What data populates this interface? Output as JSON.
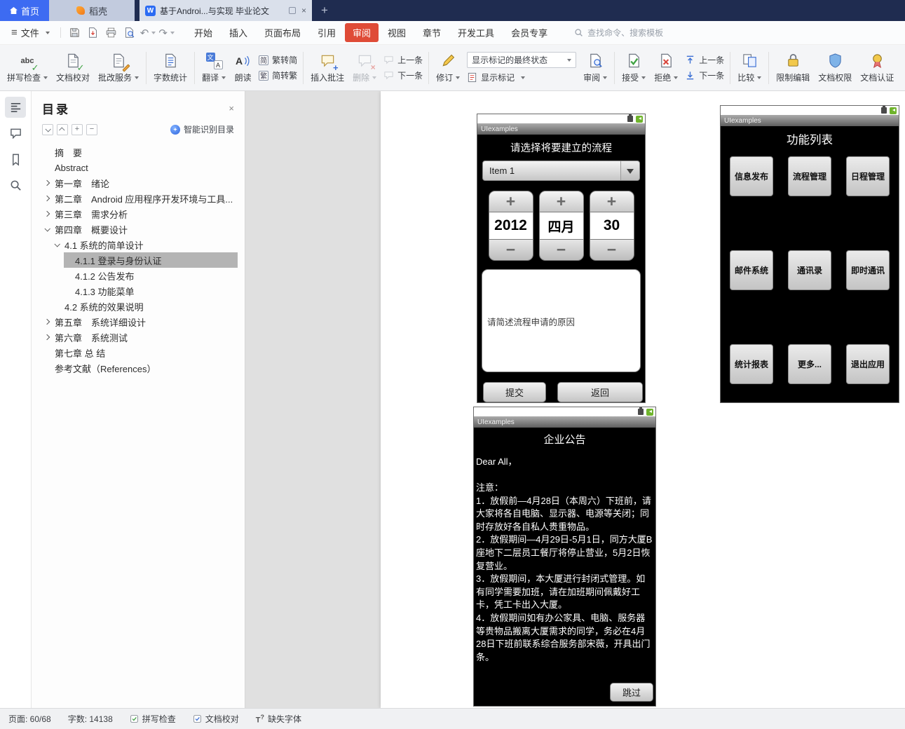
{
  "titlebar": {
    "home_tab": "首页",
    "docer_tab": "稻壳",
    "doc_tab": "基于Androi...与实现 毕业论文"
  },
  "menubar": {
    "file": "文件",
    "tabs": [
      "开始",
      "插入",
      "页面布局",
      "引用",
      "审阅",
      "视图",
      "章节",
      "开发工具",
      "会员专享"
    ],
    "search": "查找命令、搜索模板"
  },
  "ribbon": {
    "spell_check": "拼写检查",
    "doc_proof": "文档校对",
    "correction_service": "批改服务",
    "word_count": "字数统计",
    "translate": "翻译",
    "read_aloud": "朗读",
    "trad_to_simp": "繁转简",
    "simp_to_trad": "简转繁",
    "insert_comment": "插入批注",
    "delete_comment": "删除",
    "prev_comment": "上一条",
    "next_comment": "下一条",
    "track_changes": "修订",
    "markup_state": "显示标记的最终状态",
    "show_markup": "显示标记",
    "review": "审阅",
    "accept": "接受",
    "reject": "拒绝",
    "prev_change": "上一条",
    "next_change": "下一条",
    "compare": "比较",
    "restrict_edit": "限制编辑",
    "doc_permission": "文档权限",
    "doc_cert": "文档认证"
  },
  "nav": {
    "title": "目录",
    "smart": "智能识别目录",
    "items": [
      {
        "label": "摘　要"
      },
      {
        "label": "Abstract"
      },
      {
        "label": "第一章　绪论"
      },
      {
        "label": "第二章　Android 应用程序开发环境与工具..."
      },
      {
        "label": "第三章　需求分析"
      },
      {
        "label": "第四章　概要设计"
      },
      {
        "label": "4.1 系统的简单设计"
      },
      {
        "label": "4.1.1 登录与身份认证"
      },
      {
        "label": "4.1.2 公告发布"
      },
      {
        "label": "4.1.3 功能菜单"
      },
      {
        "label": "4.2 系统的效果说明"
      },
      {
        "label": "第五章　系统详细设计"
      },
      {
        "label": "第六章　系统测试"
      },
      {
        "label": "第七章 总 结"
      },
      {
        "label": "参考文献（References）"
      }
    ]
  },
  "doc": {
    "phone1": {
      "app_title": "UIexamples",
      "heading": "请选择将要建立的流程",
      "spinner_value": "Item 1",
      "year": "2012",
      "month": "四月",
      "day": "30",
      "textarea_hint": "请简述流程申请的原因",
      "submit": "提交",
      "back": "返回"
    },
    "phone2": {
      "app_title": "UIexamples",
      "heading": "功能列表",
      "buttons": [
        "信息发布",
        "流程管理",
        "日程管理",
        "邮件系统",
        "通讯录",
        "即时通讯",
        "统计报表",
        "更多...",
        "退出应用"
      ]
    },
    "phone3": {
      "app_title": "UIexamples",
      "heading": "企业公告",
      "body": "Dear All，\n\n注意：\n1．放假前—4月28日（本周六）下班前，请大家将各自电脑、显示器、电源等关闭；同时存放好各自私人贵重物品。\n2．放假期间—4月29日-5月1日，同方大厦B座地下二层员工餐厅将停止营业，5月2日恢复营业。\n3．放假期间，本大厦进行封闭式管理。如有同学需要加班，请在加班期间佩戴好工卡，凭工卡出入大厦。\n4．放假期间如有办公家具、电脑、服务器等贵物品搬离大厦需求的同学，务必在4月28日下班前联系综合服务部宋薇，开具出门条。",
      "skip": "跳过"
    }
  },
  "status": {
    "page": "页面: 60/68",
    "words": "字数: 14138",
    "spell": "拼写检查",
    "proof": "文档校对",
    "missing_font": "缺失字体"
  },
  "icons": {
    "close": "×",
    "plus": "+",
    "minus": "−",
    "w_logo": "W",
    "undo": "↶",
    "redo": "↷",
    "abc": "abc",
    "check": "✓",
    "trad": "繁",
    "simp": "简",
    "a": "A",
    "wen": "文",
    "t": "T",
    "question": "?"
  },
  "colors": {
    "titlebar_navy": "#1F2C50",
    "home_tab_blue": "#3D6BF2",
    "active_tab_red": "#DF4B37",
    "android_green": "#6FB42C"
  }
}
